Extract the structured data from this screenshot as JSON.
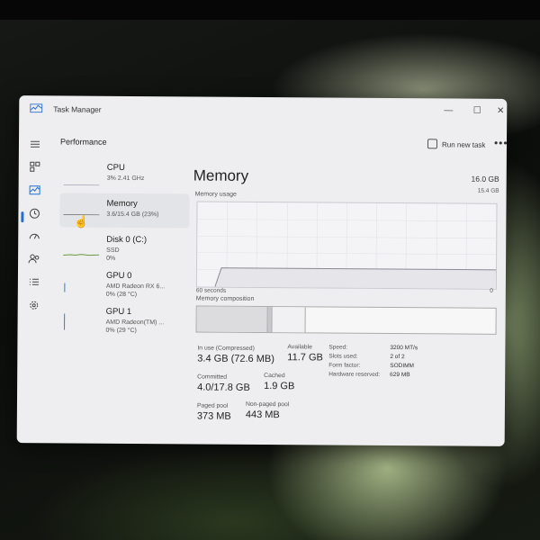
{
  "window": {
    "title": "Task Manager",
    "minimize_glyph": "—",
    "maximize_glyph": "☐",
    "close_glyph": "✕"
  },
  "header": {
    "section_title": "Performance",
    "run_new_task": "Run new task",
    "more_glyph": "•••"
  },
  "nav_icons": [
    "hamburger-icon",
    "processes-icon",
    "performance-icon",
    "app-history-icon",
    "startup-apps-icon",
    "users-icon",
    "details-icon",
    "services-icon",
    "settings-icon"
  ],
  "devices": [
    {
      "name": "CPU",
      "sub": "3%  2.41 GHz"
    },
    {
      "name": "Memory",
      "sub": "3.6/15.4 GB (23%)"
    },
    {
      "name": "Disk 0 (C:)",
      "sub": "SSD",
      "sub2": "0%"
    },
    {
      "name": "GPU 0",
      "sub": "AMD Radeon RX 6...",
      "sub2": "0%  (28 °C)"
    },
    {
      "name": "GPU 1",
      "sub": "AMD Radeon(TM) ...",
      "sub2": "0%  (29 °C)"
    }
  ],
  "memory": {
    "title": "Memory",
    "total": "16.0 GB",
    "usage_label": "Memory usage",
    "usage_max": "15.4 GB",
    "axis_left": "60 seconds",
    "axis_right": "0",
    "composition_label": "Memory composition",
    "stats": {
      "in_use_label": "In use (Compressed)",
      "in_use": "3.4 GB (72.6 MB)",
      "available_label": "Available",
      "available": "11.7 GB",
      "committed_label": "Committed",
      "committed": "4.0/17.8 GB",
      "cached_label": "Cached",
      "cached": "1.9 GB",
      "paged_label": "Paged pool",
      "paged": "373 MB",
      "nonpaged_label": "Non-paged pool",
      "nonpaged": "443 MB"
    },
    "props": [
      {
        "k": "Speed:",
        "v": "3200 MT/s"
      },
      {
        "k": "Slots used:",
        "v": "2 of 2"
      },
      {
        "k": "Form factor:",
        "v": "SODIMM"
      },
      {
        "k": "Hardware reserved:",
        "v": "629 MB"
      }
    ]
  },
  "colors": {
    "accent": "#1f6fd8",
    "window_bg": "#eeeef0",
    "graph_border": "#c9c9d0"
  }
}
